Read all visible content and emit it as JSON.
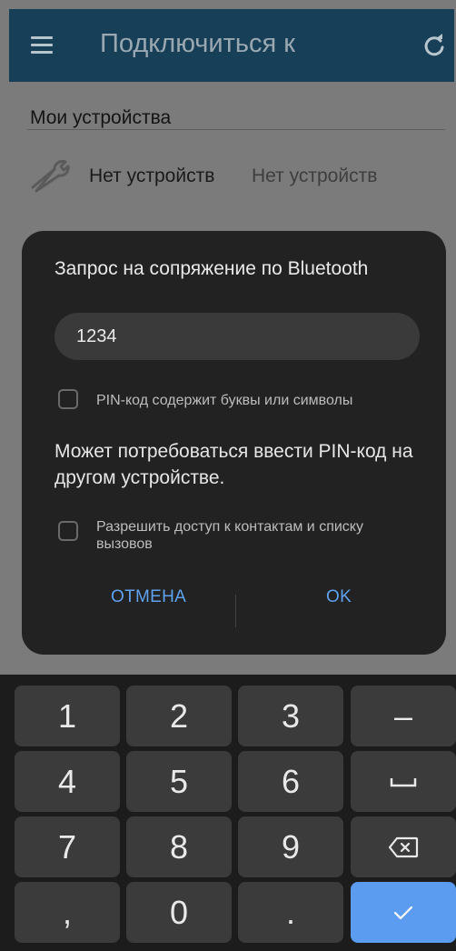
{
  "app_bar": {
    "title": "Подключиться к"
  },
  "page": {
    "section_title": "Мои устройства",
    "device_name": "Нет устройств",
    "device_status": "Нет устройств"
  },
  "dialog": {
    "title": "Запрос на сопряжение по Bluetooth",
    "pin_value": "1234",
    "pin_contains_letters_label": "PIN-код содержит буквы или символы",
    "message": "Может потребоваться ввести PIN-код на другом устройстве.",
    "contacts_access_label": "Разрешить доступ к контактам и списку вызовов",
    "cancel_label": "ОТМЕНА",
    "ok_label": "OK",
    "accent_color": "#5fa2ef"
  },
  "keyboard": {
    "keys": [
      "1",
      "2",
      "3",
      "–",
      "4",
      "5",
      "6",
      "␣",
      "7",
      "8",
      "9",
      "⌫",
      ",",
      "0",
      ".",
      "✓"
    ],
    "confirm_color": "#5b9bf0"
  },
  "icons": {
    "menu": "menu-icon",
    "refresh": "refresh-icon",
    "device": "wrench-icon"
  }
}
